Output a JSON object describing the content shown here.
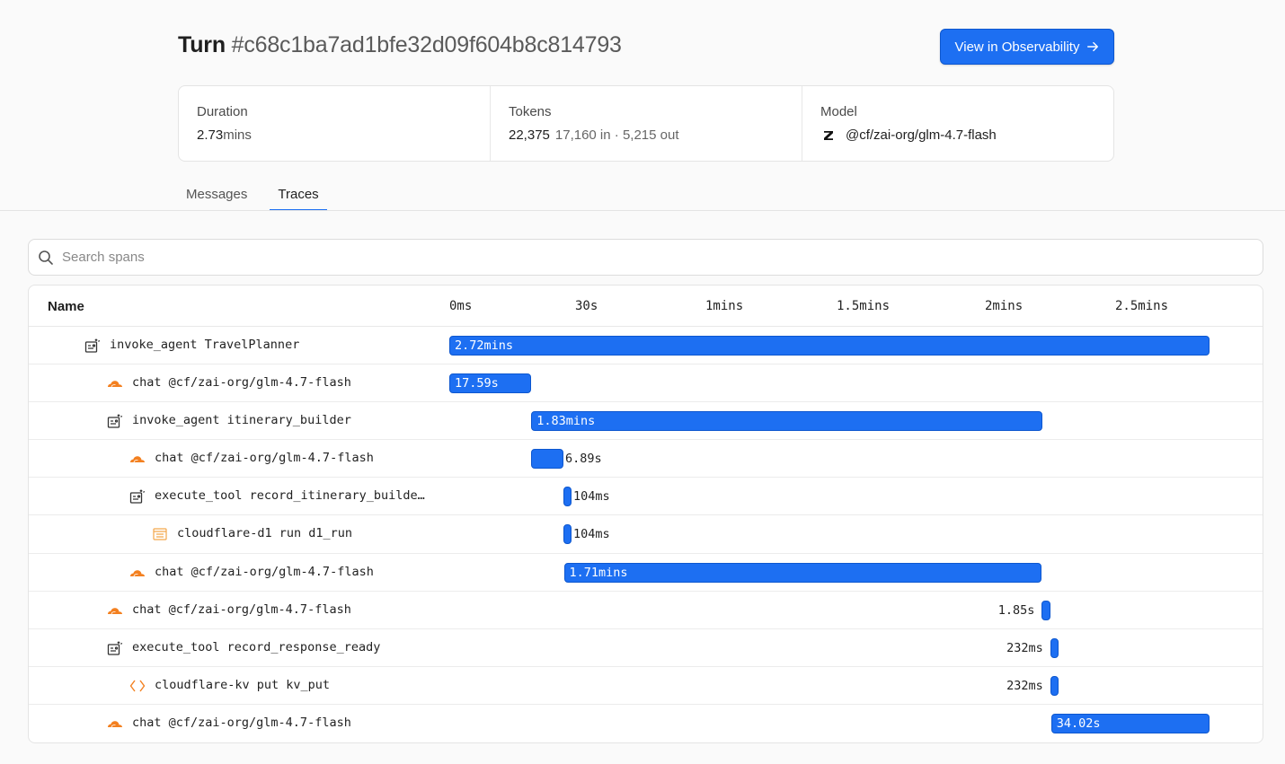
{
  "header": {
    "title_prefix": "Turn",
    "turn_id": "#c68c1ba7ad1bfe32d09f604b8c814793",
    "observability_button": "View in Observability"
  },
  "stats": {
    "duration": {
      "label": "Duration",
      "value": "2.73",
      "unit": "mins"
    },
    "tokens": {
      "label": "Tokens",
      "value": "22,375",
      "detail": "17,160 in · 5,215 out"
    },
    "model": {
      "label": "Model",
      "value": "@cf/zai-org/glm-4.7-flash"
    }
  },
  "tabs": [
    {
      "label": "Messages",
      "active": false
    },
    {
      "label": "Traces",
      "active": true
    }
  ],
  "search": {
    "placeholder": "Search spans"
  },
  "table": {
    "name_header": "Name",
    "ticks": [
      "0ms",
      "30s",
      "1mins",
      "1.5mins",
      "2mins",
      "2.5mins"
    ],
    "colors": {
      "bar": "#1d6ff2",
      "cloud": "#f38020",
      "d1": "#f3a64a",
      "kv": "#f38020",
      "agent": "#333333"
    },
    "rows": [
      {
        "name": "invoke_agent TravelPlanner",
        "icon": "agent-icon",
        "depth": 0,
        "start_s": 0,
        "dur_s": 163.2,
        "label": "2.72mins",
        "label_inside": true
      },
      {
        "name": "chat @cf/zai-org/glm-4.7-flash",
        "icon": "cloud-icon",
        "depth": 1,
        "start_s": 0,
        "dur_s": 17.59,
        "label": "17.59s",
        "label_inside": true
      },
      {
        "name": "invoke_agent itinerary_builder",
        "icon": "agent-icon",
        "depth": 1,
        "start_s": 17.6,
        "dur_s": 109.8,
        "label": "1.83mins",
        "label_inside": true
      },
      {
        "name": "chat @cf/zai-org/glm-4.7-flash",
        "icon": "cloud-icon",
        "depth": 2,
        "start_s": 17.6,
        "dur_s": 6.89,
        "label": "6.89s",
        "label_inside": false,
        "label_side": "right"
      },
      {
        "name": "execute_tool record_itinerary_builde…",
        "icon": "agent-icon",
        "depth": 2,
        "start_s": 24.5,
        "dur_s": 0.104,
        "label": "104ms",
        "label_inside": false,
        "label_side": "right"
      },
      {
        "name": "cloudflare-d1 run d1_run",
        "icon": "d1-icon",
        "depth": 3,
        "start_s": 24.5,
        "dur_s": 0.104,
        "label": "104ms",
        "label_inside": false,
        "label_side": "right"
      },
      {
        "name": "chat @cf/zai-org/glm-4.7-flash",
        "icon": "cloud-icon",
        "depth": 2,
        "start_s": 24.6,
        "dur_s": 102.6,
        "label": "1.71mins",
        "label_inside": true
      },
      {
        "name": "chat @cf/zai-org/glm-4.7-flash",
        "icon": "cloud-icon",
        "depth": 1,
        "start_s": 127.2,
        "dur_s": 1.85,
        "label": "1.85s",
        "label_inside": false,
        "label_side": "left"
      },
      {
        "name": "execute_tool record_response_ready",
        "icon": "agent-icon",
        "depth": 1,
        "start_s": 129.0,
        "dur_s": 0.232,
        "label": "232ms",
        "label_inside": false,
        "label_side": "left"
      },
      {
        "name": "cloudflare-kv put kv_put",
        "icon": "kv-icon",
        "depth": 2,
        "start_s": 129.0,
        "dur_s": 0.232,
        "label": "232ms",
        "label_inside": false,
        "label_side": "left"
      },
      {
        "name": "chat @cf/zai-org/glm-4.7-flash",
        "icon": "cloud-icon",
        "depth": 1,
        "start_s": 129.2,
        "dur_s": 34.02,
        "label": "34.02s",
        "label_inside": true
      }
    ]
  }
}
